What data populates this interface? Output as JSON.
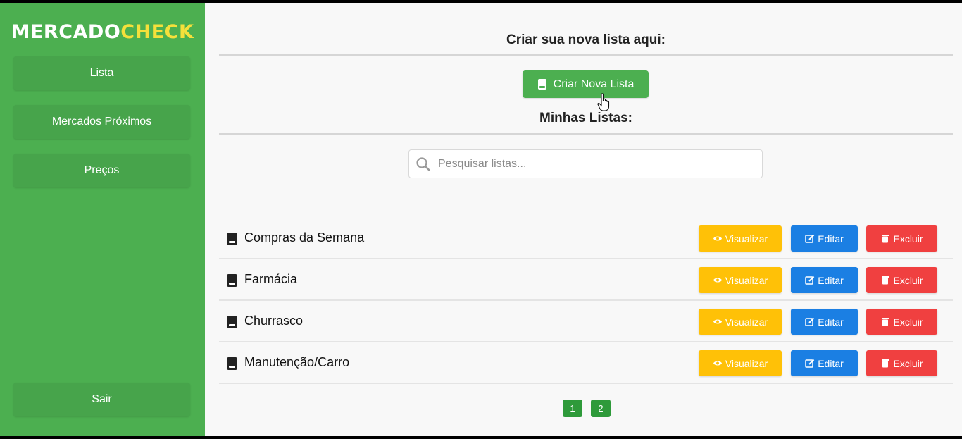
{
  "brand": {
    "logo_part1": "MERCADO",
    "logo_part2": "CHECK",
    "primary_color": "#4caf50",
    "logo_accent": "#f5e03b"
  },
  "sidebar": {
    "items": [
      {
        "label": "Lista"
      },
      {
        "label": "Mercados Próximos"
      },
      {
        "label": "Preços"
      }
    ],
    "logout_label": "Sair"
  },
  "main": {
    "create_heading": "Criar sua nova lista aqui:",
    "create_button": {
      "label": "Criar Nova Lista",
      "icon": "book-icon"
    },
    "lists_heading": "Minhas Listas:",
    "search": {
      "placeholder": "Pesquisar listas...",
      "value": "",
      "icon": "search-icon"
    },
    "lists": [
      {
        "name": "Compras da Semana"
      },
      {
        "name": "Farmácia"
      },
      {
        "name": "Churrasco"
      },
      {
        "name": "Manutenção/Carro"
      }
    ],
    "actions": {
      "view_label": "Visualizar",
      "view_icon": "eye-icon",
      "view_color": "#ffc107",
      "edit_label": "Editar",
      "edit_icon": "edit-icon",
      "edit_color": "#1b7fe3",
      "delete_label": "Excluir",
      "delete_icon": "trash-icon",
      "delete_color": "#f04040"
    },
    "pagination": {
      "pages": [
        "1",
        "2"
      ]
    }
  }
}
